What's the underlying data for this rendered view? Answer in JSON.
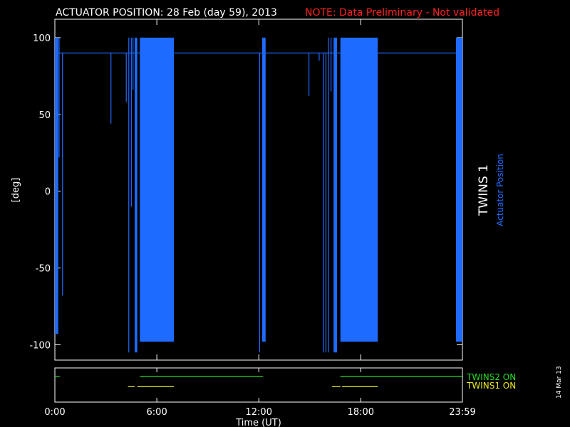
{
  "header": {
    "title": "ACTUATOR POSITION: 28 Feb (day  59), 2013",
    "note": "NOTE: Data Preliminary - Not validated"
  },
  "colors": {
    "background": "#000000",
    "axes": "#ffffff",
    "actuator": "#1e6bff",
    "twins2": "#22dd22",
    "twins1": "#e8e820",
    "note": "#ff2020"
  },
  "side": {
    "instrument": "TWINS 1",
    "quantity": "Actuator Position",
    "date_stamp": "14 Mar 13"
  },
  "chart_data": [
    {
      "type": "line",
      "ylabel": "[deg]",
      "ylim": [
        -110,
        112
      ],
      "xlim": [
        0,
        23.98
      ],
      "yticks": [
        {
          "value": 100,
          "label": "100"
        },
        {
          "value": 50,
          "label": "50"
        },
        {
          "value": 0,
          "label": "0"
        },
        {
          "value": -50,
          "label": "-50"
        },
        {
          "value": -100,
          "label": "-100"
        }
      ],
      "baseline": 90,
      "blocks": [
        {
          "x0": 0.0,
          "x1": 0.2,
          "ymin": -93,
          "ymax": 100
        },
        {
          "x0": 4.7,
          "x1": 4.85,
          "ymin": -105,
          "ymax": 100
        },
        {
          "x0": 5.0,
          "x1": 7.0,
          "ymin": -98,
          "ymax": 100
        },
        {
          "x0": 12.2,
          "x1": 12.4,
          "ymin": -98,
          "ymax": 100
        },
        {
          "x0": 16.4,
          "x1": 16.6,
          "ymin": -105,
          "ymax": 100
        },
        {
          "x0": 16.8,
          "x1": 19.0,
          "ymin": -98,
          "ymax": 100
        },
        {
          "x0": 23.6,
          "x1": 23.98,
          "ymin": -98,
          "ymax": 100
        }
      ],
      "spikes": [
        {
          "x": 0.25,
          "ymin": 22,
          "ymax": 100
        },
        {
          "x": 0.45,
          "ymin": -68,
          "ymax": 90
        },
        {
          "x": 3.3,
          "ymin": 44,
          "ymax": 90
        },
        {
          "x": 4.2,
          "ymin": 58,
          "ymax": 90
        },
        {
          "x": 4.35,
          "ymin": -105,
          "ymax": 100
        },
        {
          "x": 4.5,
          "ymin": -10,
          "ymax": 100
        },
        {
          "x": 4.6,
          "ymin": 66,
          "ymax": 100
        },
        {
          "x": 12.05,
          "ymin": -105,
          "ymax": 90
        },
        {
          "x": 14.95,
          "ymin": 62,
          "ymax": 90
        },
        {
          "x": 15.55,
          "ymin": 85,
          "ymax": 90
        },
        {
          "x": 15.8,
          "ymin": -105,
          "ymax": 90
        },
        {
          "x": 15.95,
          "ymin": -105,
          "ymax": 90
        },
        {
          "x": 16.1,
          "ymin": -105,
          "ymax": 100
        },
        {
          "x": 16.25,
          "ymin": 65,
          "ymax": 100
        }
      ],
      "status_bars": [
        {
          "name": "TWINS2 ON",
          "color": "#22dd22",
          "level": 0.25,
          "segments": [
            [
              0.0,
              0.3
            ],
            [
              5.0,
              12.25
            ],
            [
              16.8,
              23.98
            ]
          ]
        },
        {
          "name": "TWINS1 ON",
          "color": "#e8e820",
          "level": 0.55,
          "segments": [
            [
              4.3,
              4.7
            ],
            [
              4.85,
              7.0
            ],
            [
              16.3,
              16.8
            ],
            [
              16.9,
              19.0
            ]
          ]
        }
      ],
      "xticks": [
        {
          "value": 0,
          "label": "0:00"
        },
        {
          "value": 6,
          "label": "6:00"
        },
        {
          "value": 12,
          "label": "12:00"
        },
        {
          "value": 18,
          "label": "18:00"
        },
        {
          "value": 23.98,
          "label": "23:59"
        }
      ],
      "xlabel": "Time (UT)"
    }
  ]
}
